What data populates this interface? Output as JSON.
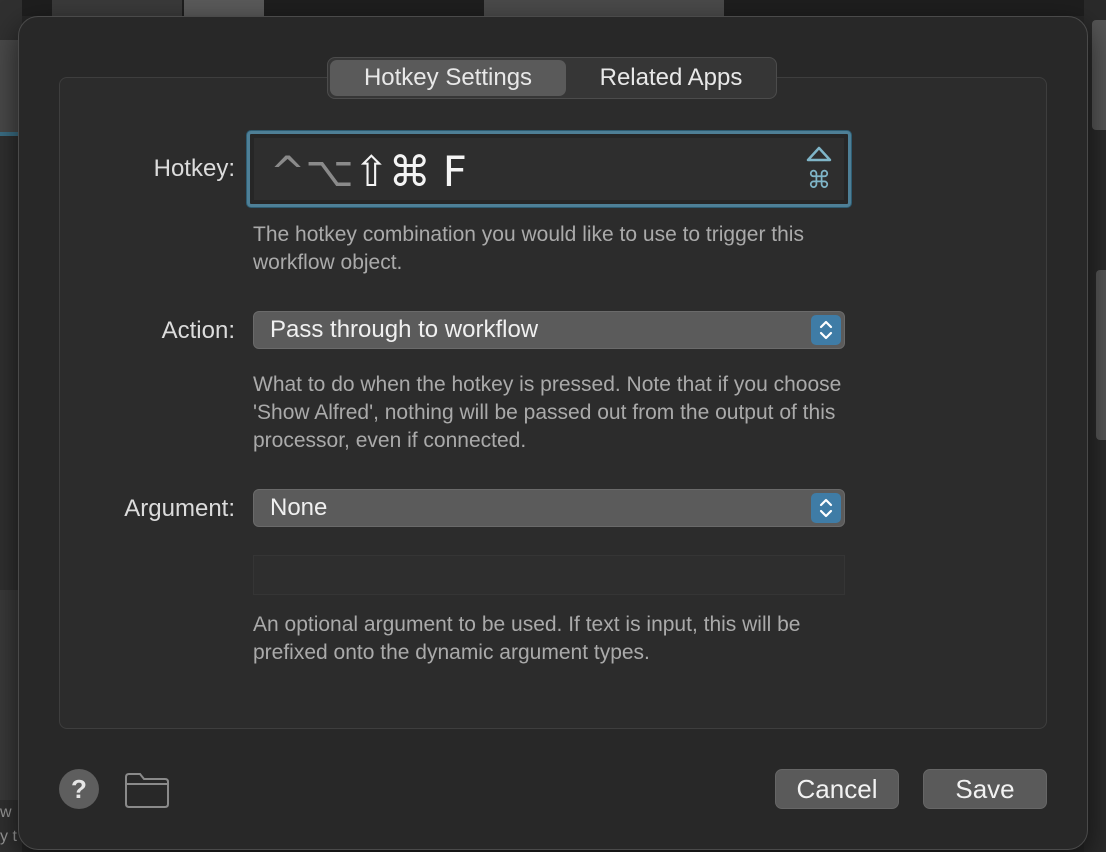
{
  "tabs": [
    {
      "label": "Hotkey Settings",
      "active": true
    },
    {
      "label": "Related Apps",
      "active": false
    }
  ],
  "hotkey": {
    "label": "Hotkey:",
    "modifiers_inactive": "^⌥",
    "modifiers_active": "⇧⌘",
    "key": "F",
    "help": "The hotkey combination you would like to use to trigger this workflow object."
  },
  "action": {
    "label": "Action:",
    "value": "Pass through to workflow",
    "help": "What to do when the hotkey is pressed. Note that if you choose 'Show Alfred', nothing will be passed out from the output of this processor, even if connected."
  },
  "argument": {
    "label": "Argument:",
    "value": "None",
    "text_value": "",
    "help": "An optional argument to be used. If text is input, this will be prefixed onto the dynamic argument types."
  },
  "footer": {
    "help_glyph": "?",
    "cancel_label": "Cancel",
    "save_label": "Save"
  },
  "background": {
    "bottom_text_1": "w",
    "bottom_text_2": "y t"
  },
  "colors": {
    "accent": "#3f7ca6",
    "focus_ring": "#4e7f96",
    "sheet_bg": "#282828"
  }
}
